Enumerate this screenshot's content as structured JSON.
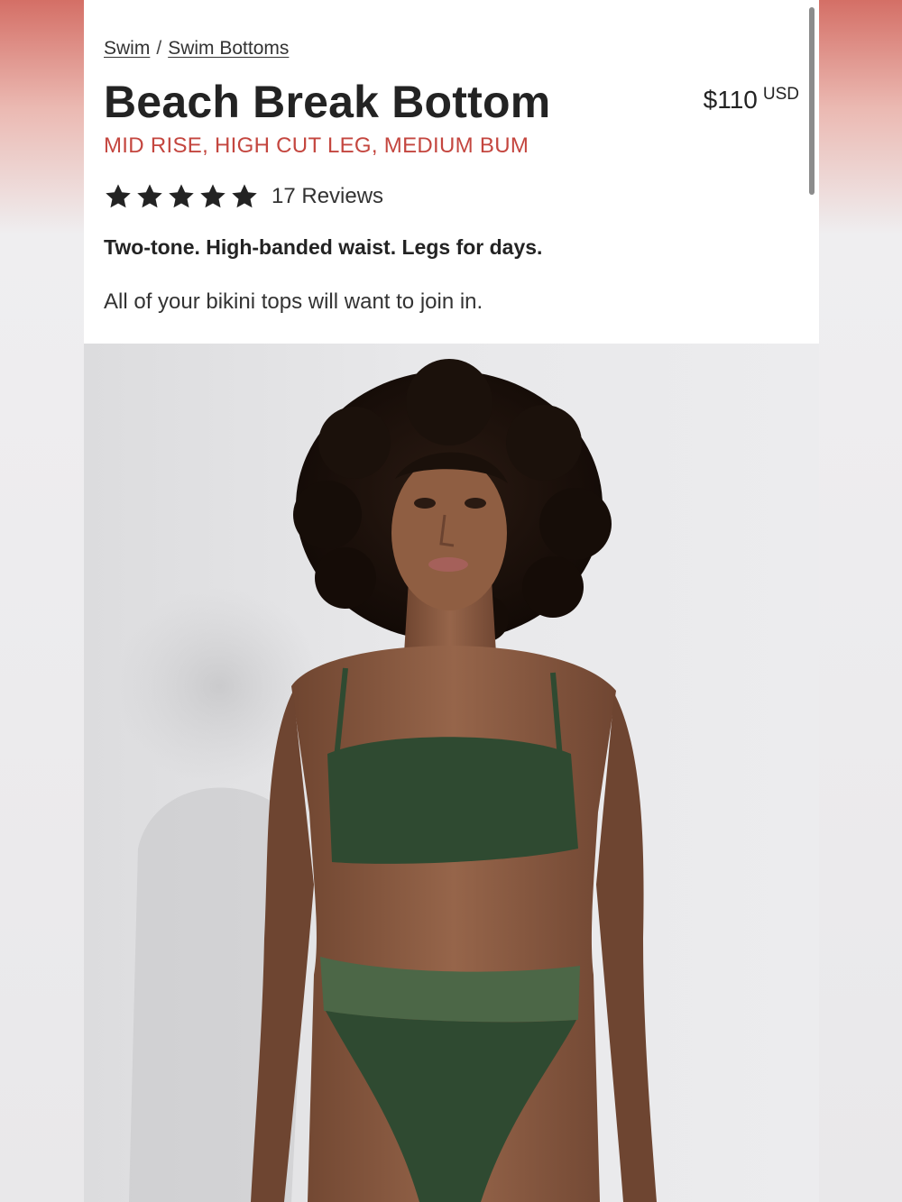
{
  "breadcrumb": {
    "items": [
      "Swim",
      "Swim Bottoms"
    ],
    "separator": "/"
  },
  "product": {
    "title": "Beach Break Bottom",
    "subtitle": "MID RISE, HIGH CUT LEG, MEDIUM BUM",
    "price": "$110",
    "currency": "USD",
    "rating": 5,
    "reviews": "17 Reviews",
    "tagline": "Two-tone. High-banded waist. Legs for days.",
    "description": "All of your bikini tops will want to join in."
  },
  "colors": {
    "accent": "#c4463f",
    "text": "#232323",
    "swimsuit": "#2f4a31",
    "swimsuit_band": "#4c6747",
    "skin": "#8a5a3e"
  },
  "icons": {
    "star": "star-icon"
  }
}
